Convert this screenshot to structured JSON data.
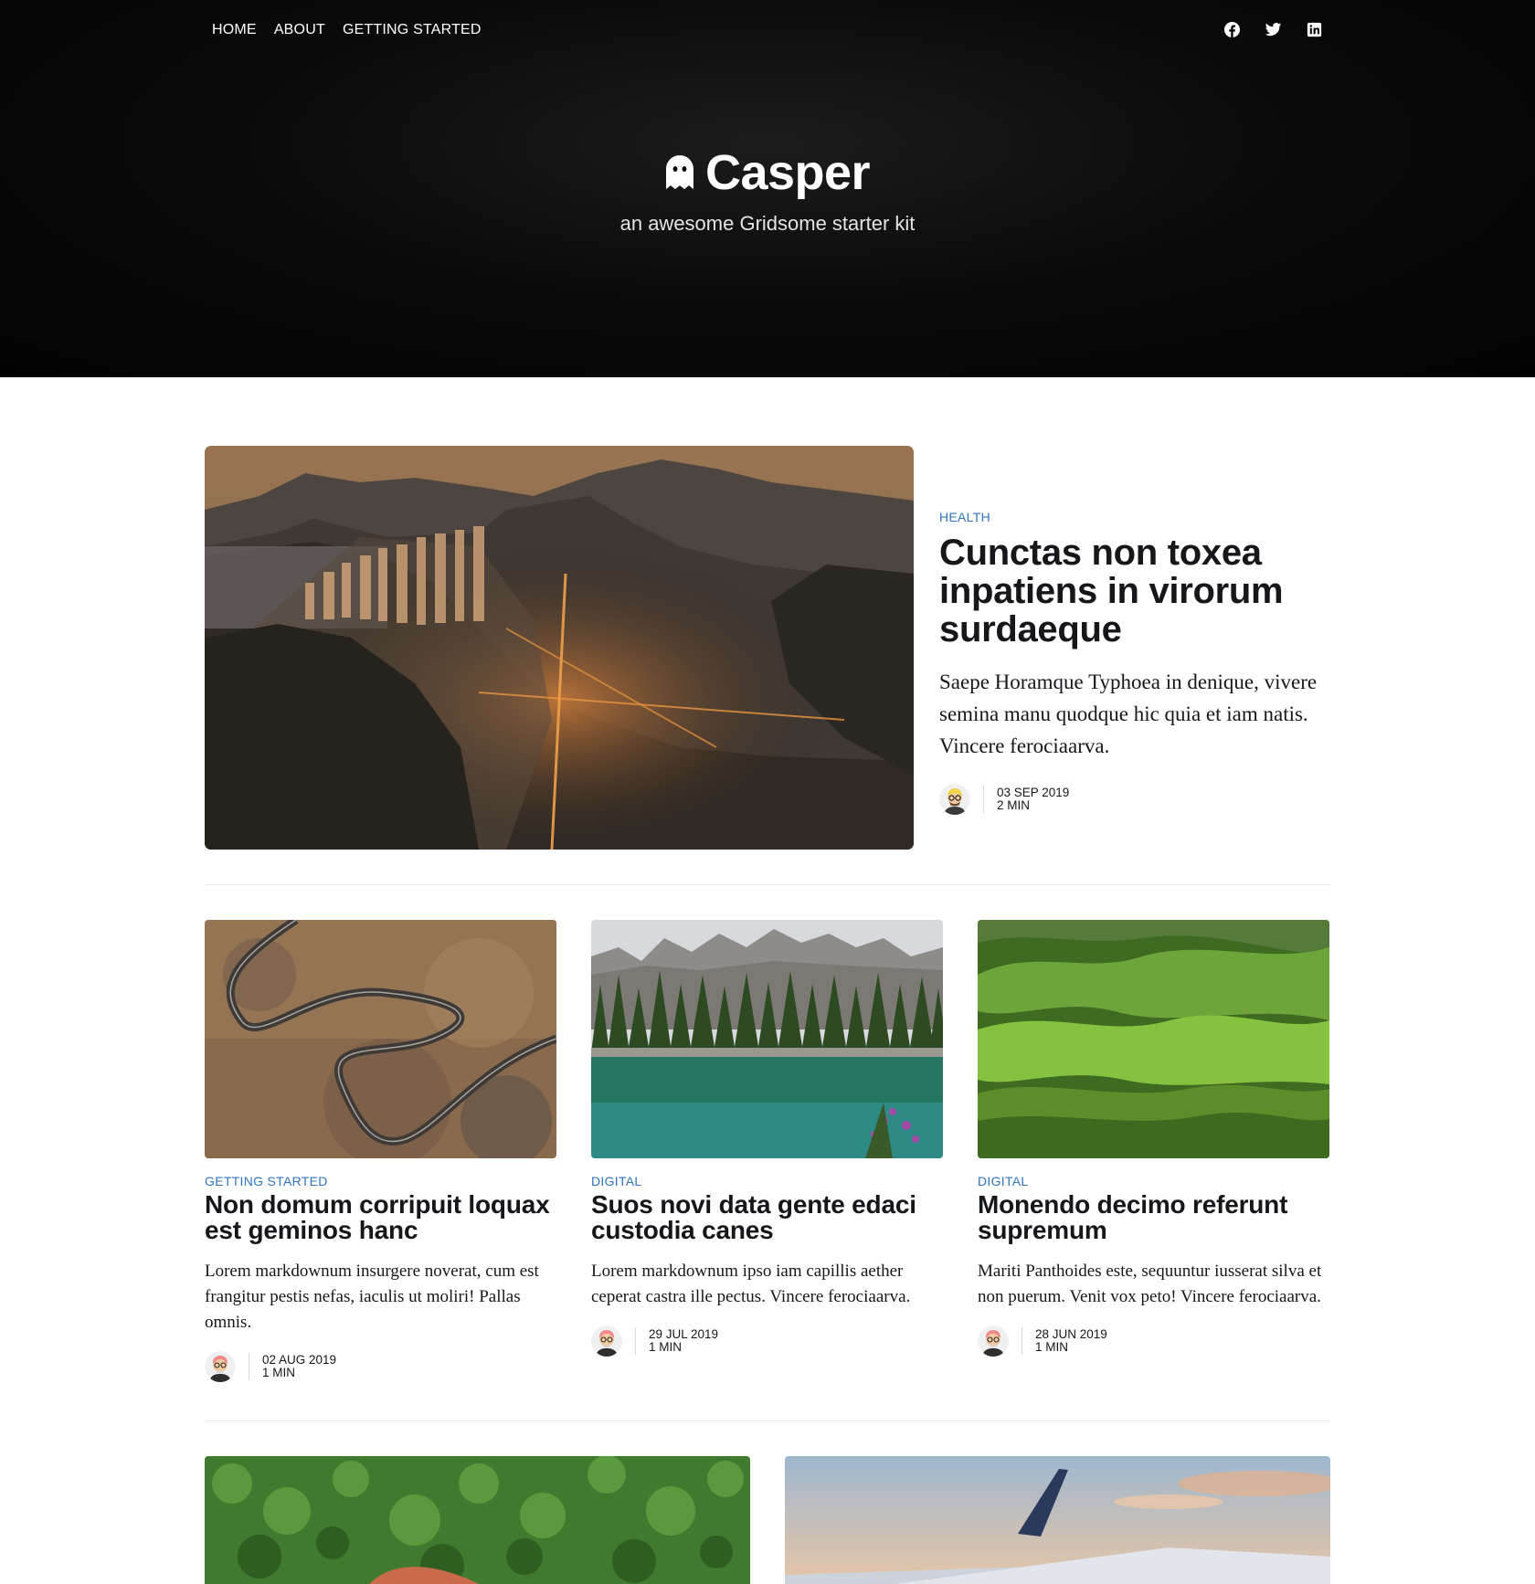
{
  "nav": {
    "links": [
      "HOME",
      "ABOUT",
      "GETTING STARTED"
    ],
    "social": [
      "facebook-icon",
      "twitter-icon",
      "linkedin-icon"
    ]
  },
  "site": {
    "title": "Casper",
    "description": "an awesome Gridsome starter kit",
    "logo_icon": "ghost-icon"
  },
  "colors": {
    "accent": "#2f74c0",
    "hero_bg": "#050505",
    "text": "#15171a"
  },
  "featured": {
    "tag": "HEALTH",
    "title": "Cunctas non toxea inpatiens in virorum surdaeque",
    "excerpt": "Saepe Horamque Typhoea in denique, vivere semina manu quodque hic quia et iam natis. Vincere ferociaarva.",
    "date": "03 SEP 2019",
    "read_time": "2 MIN",
    "image": "city-night-aerial-image"
  },
  "posts": [
    {
      "tag": "GETTING STARTED",
      "title": "Non domum corripuit loquax est geminos hanc",
      "excerpt": "Lorem markdownum insurgere noverat, cum est frangitur pestis nefas, iaculis ut moliri! Pallas omnis.",
      "date": "02 AUG 2019",
      "read_time": "1 MIN",
      "image": "winding-road-image"
    },
    {
      "tag": "DIGITAL",
      "title": "Suos novi data gente edaci custodia canes",
      "excerpt": "Lorem markdownum ipso iam capillis aether ceperat castra ille pectus. Vincere ferociaarva.",
      "date": "29 JUL 2019",
      "read_time": "1 MIN",
      "image": "mountain-lake-image"
    },
    {
      "tag": "DIGITAL",
      "title": "Monendo decimo referunt supremum",
      "excerpt": "Mariti Panthoides este, sequuntur iusserat silva et non puerum. Venit vox peto! Vincere ferociaarva.",
      "date": "28 JUN 2019",
      "read_time": "1 MIN",
      "image": "green-hills-image"
    }
  ],
  "bottom_posts": [
    {
      "image": "aerial-forest-image"
    },
    {
      "image": "airplane-wing-image"
    }
  ]
}
